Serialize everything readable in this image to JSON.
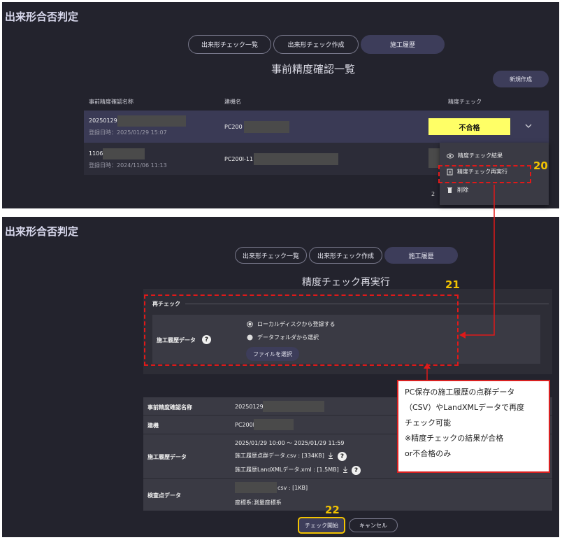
{
  "top": {
    "app_title": "出来形合否判定",
    "tabs": [
      "出来形チェック一覧",
      "出来形チェック作成",
      "施工履歴"
    ],
    "page_title": "事前精度確認一覧",
    "new_button": "新規作成",
    "columns": [
      "事前精度確認名称",
      "建機名",
      "精度チェック"
    ],
    "rows": [
      {
        "name": "20250129",
        "date": "登録日時：2025/01/29 15:07",
        "machine": "PC200",
        "status": "不合格"
      },
      {
        "name": "1106",
        "date": "登録日時：2024/11/06 11:13",
        "machine": "PC200I-11",
        "status": ""
      }
    ],
    "partial_char": "2",
    "menu": [
      "精度チェック結果",
      "精度チェック再実行",
      "削除"
    ],
    "callout_number": "20"
  },
  "bottom": {
    "app_title": "出来形合否判定",
    "tabs": [
      "出来形チェック一覧",
      "出来形チェック作成",
      "施工履歴"
    ],
    "page_title": "精度チェック再実行",
    "section_title": "再チェック",
    "field_label": "施工履歴データ",
    "radio_local": "ローカルディスクから登録する",
    "radio_folder": "データフォルダから選択",
    "file_button": "ファイルを選択",
    "callout_number_21": "21",
    "info": {
      "name_label": "事前精度確認名称",
      "name_value": "20250129_",
      "machine_label": "建機",
      "machine_value": "PC200I",
      "history_label": "施工履歴データ",
      "history_period": "2025/01/29 10:00 ～ 2025/01/29 11:59",
      "history_file1": "施工履歴点群データ.csv : [334KB]",
      "history_file2": "施工履歴LandXMLデータ.xml : [1.5MB]",
      "check_label": "検査点データ",
      "check_file": "csv : [1KB]",
      "check_coord": "座標系:測量座標系"
    },
    "note_lines": [
      "PC保存の施工履歴の点群データ",
      "（CSV）やLandXMLデータで再度",
      "チェック可能",
      "※精度チェックの結果が合格",
      "or不合格のみ"
    ],
    "start_button": "チェック開始",
    "cancel_button": "キャンセル",
    "callout_number_22": "22"
  }
}
